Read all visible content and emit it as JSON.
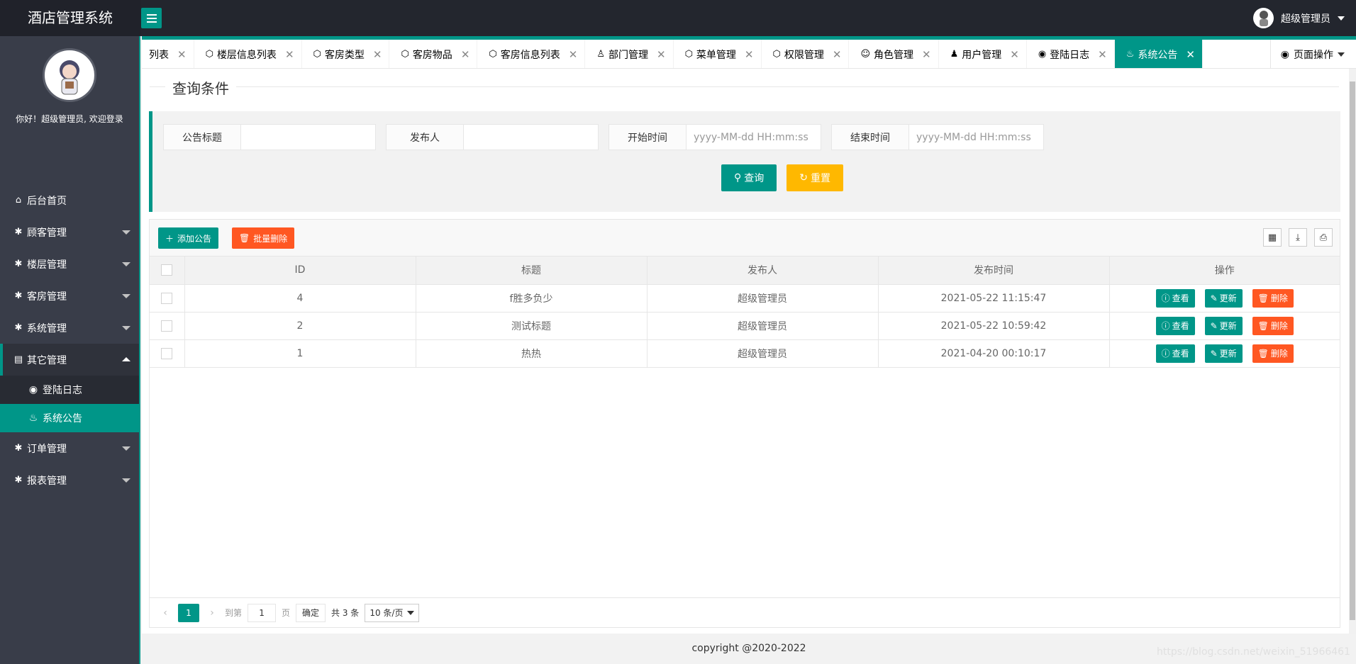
{
  "app": {
    "title": "酒店管理系统",
    "user": "超级管理员"
  },
  "sidebar": {
    "welcome": "你好！超级管理员, 欢迎登录",
    "items": [
      {
        "label": "后台首页",
        "icon": "home-icon"
      },
      {
        "label": "顾客管理",
        "icon": "gear-icon"
      },
      {
        "label": "楼层管理",
        "icon": "gear-icon"
      },
      {
        "label": "客房管理",
        "icon": "gear-icon"
      },
      {
        "label": "系统管理",
        "icon": "gear-icon"
      },
      {
        "label": "其它管理",
        "icon": "clipboard-icon",
        "sub": [
          {
            "label": "登陆日志",
            "icon": "weibo-icon"
          },
          {
            "label": "系统公告",
            "icon": "fire-icon"
          }
        ]
      },
      {
        "label": "订单管理",
        "icon": "gear-icon"
      },
      {
        "label": "报表管理",
        "icon": "gear-icon"
      }
    ]
  },
  "tabs": [
    {
      "label": "列表",
      "icon": ""
    },
    {
      "label": "楼层信息列表",
      "icon": "cube-icon"
    },
    {
      "label": "客房类型",
      "icon": "cube-icon"
    },
    {
      "label": "客房物品",
      "icon": "cube-icon"
    },
    {
      "label": "客房信息列表",
      "icon": "cube-icon"
    },
    {
      "label": "部门管理",
      "icon": "user-icon"
    },
    {
      "label": "菜单管理",
      "icon": "cube-icon"
    },
    {
      "label": "权限管理",
      "icon": "cube-icon"
    },
    {
      "label": "角色管理",
      "icon": "smile-icon"
    },
    {
      "label": "用户管理",
      "icon": "user-icon"
    },
    {
      "label": "登陆日志",
      "icon": "weibo-icon"
    },
    {
      "label": "系统公告",
      "icon": "fire-icon"
    }
  ],
  "page_ops": "页面操作",
  "search": {
    "legend": "查询条件",
    "fields": [
      {
        "label": "公告标题",
        "placeholder": ""
      },
      {
        "label": "发布人",
        "placeholder": ""
      },
      {
        "label": "开始时间",
        "placeholder": "yyyy-MM-dd HH:mm:ss"
      },
      {
        "label": "结束时间",
        "placeholder": "yyyy-MM-dd HH:mm:ss"
      }
    ],
    "query_label": "查询",
    "reset_label": "重置"
  },
  "toolbar": {
    "add_label": "添加公告",
    "batch_delete_label": "批量删除"
  },
  "table": {
    "headers": [
      "ID",
      "标题",
      "发布人",
      "发布时间",
      "操作"
    ],
    "rows": [
      {
        "id": "4",
        "title": "f胜多负少",
        "author": "超级管理员",
        "time": "2021-05-22 11:15:47"
      },
      {
        "id": "2",
        "title": "测试标题",
        "author": "超级管理员",
        "time": "2021-05-22 10:59:42"
      },
      {
        "id": "1",
        "title": "热热",
        "author": "超级管理员",
        "time": "2021-04-20 00:10:17"
      }
    ],
    "actions": {
      "view": "查看",
      "update": "更新",
      "delete": "删除"
    }
  },
  "pager": {
    "current": "1",
    "goto_label": "到第",
    "page_input": "1",
    "page_unit": "页",
    "confirm": "确定",
    "total": "共 3 条",
    "page_size": "10 条/页"
  },
  "footer": "copyright @2020-2022",
  "watermark": "https://blog.csdn.net/weixin_51966461",
  "colors": {
    "primary": "#009688",
    "warn": "#ffb800",
    "danger": "#ff5722",
    "header": "#23262e",
    "sidebar": "#393d49"
  }
}
